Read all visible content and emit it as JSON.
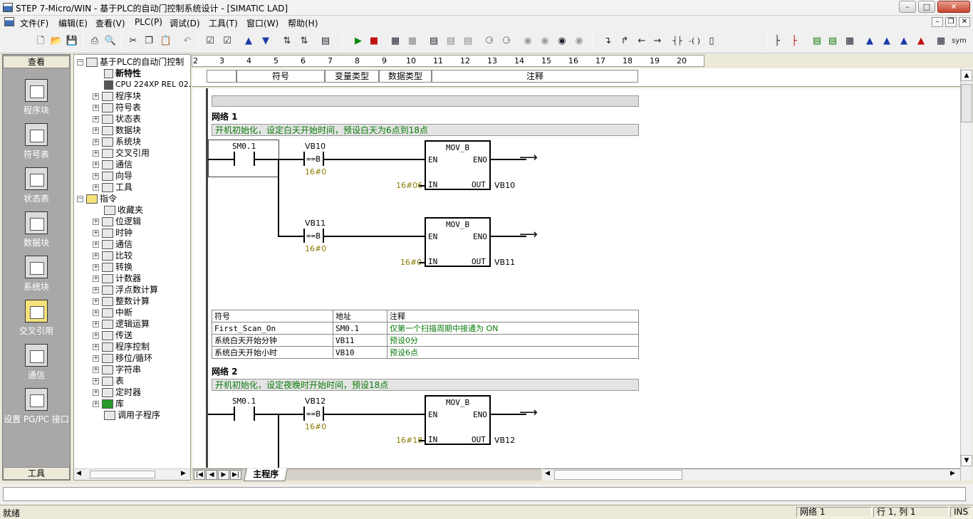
{
  "window": {
    "title": "STEP 7-Micro/WIN - 基于PLC的自动门控制系统设计 - [SIMATIC LAD]"
  },
  "menu": [
    {
      "label": "文件(F)"
    },
    {
      "label": "编辑(E)"
    },
    {
      "label": "查看(V)"
    },
    {
      "label": "PLC(P)"
    },
    {
      "label": "调试(D)"
    },
    {
      "label": "工具(T)"
    },
    {
      "label": "窗口(W)"
    },
    {
      "label": "帮助(H)"
    }
  ],
  "nav": {
    "header": "查看",
    "footer": "工具",
    "items": [
      {
        "label": "程序块",
        "icon": "program-block-icon"
      },
      {
        "label": "符号表",
        "icon": "symbol-table-icon"
      },
      {
        "label": "状态表",
        "icon": "status-table-icon"
      },
      {
        "label": "数据块",
        "icon": "data-block-icon"
      },
      {
        "label": "系统块",
        "icon": "system-block-icon"
      },
      {
        "label": "交叉引用",
        "icon": "cross-reference-icon"
      },
      {
        "label": "通信",
        "icon": "communication-icon"
      },
      {
        "label": "设置 PG/PC 接口",
        "icon": "pgpc-interface-icon"
      }
    ]
  },
  "tree": {
    "root": "基于PLC的自动门控制",
    "items": [
      {
        "label": "新特性"
      },
      {
        "label": "CPU 224XP REL 02."
      },
      {
        "label": "程序块"
      },
      {
        "label": "符号表"
      },
      {
        "label": "状态表"
      },
      {
        "label": "数据块"
      },
      {
        "label": "系统块"
      },
      {
        "label": "交叉引用"
      },
      {
        "label": "通信"
      },
      {
        "label": "向导"
      },
      {
        "label": "工具"
      }
    ],
    "instructions": "指令",
    "instr_items": [
      {
        "label": "收藏夹"
      },
      {
        "label": "位逻辑"
      },
      {
        "label": "时钟"
      },
      {
        "label": "通信"
      },
      {
        "label": "比较"
      },
      {
        "label": "转换"
      },
      {
        "label": "计数器"
      },
      {
        "label": "浮点数计算"
      },
      {
        "label": "整数计算"
      },
      {
        "label": "中断"
      },
      {
        "label": "逻辑运算"
      },
      {
        "label": "传送"
      },
      {
        "label": "程序控制"
      },
      {
        "label": "移位/循环"
      },
      {
        "label": "字符串"
      },
      {
        "label": "表"
      },
      {
        "label": "定时器"
      },
      {
        "label": "库"
      },
      {
        "label": "调用子程序"
      }
    ]
  },
  "ruler": [
    "2",
    "3",
    "4",
    "5",
    "6",
    "7",
    "8",
    "9",
    "10",
    "11",
    "12",
    "13",
    "14",
    "15",
    "16",
    "17",
    "18",
    "19",
    "20"
  ],
  "symbol_header": {
    "col1": "符号",
    "col2": "变量类型",
    "col3": "数据类型",
    "col4": "注释"
  },
  "network1": {
    "title": "网络 1",
    "comment": "开机初始化，设定白天开始时间，预设白天为6点到18点",
    "contact": "SM0.1",
    "rung1": {
      "compare_var": "VB10",
      "compare_op": "==B",
      "compare_val": "16#0",
      "block": "MOV_B",
      "en": "EN",
      "eno": "ENO",
      "in_val": "16#06",
      "in": "IN",
      "out": "OUT",
      "out_var": "VB10"
    },
    "rung2": {
      "compare_var": "VB11",
      "compare_op": "==B",
      "compare_val": "16#0",
      "block": "MOV_B",
      "en": "EN",
      "eno": "ENO",
      "in_val": "16#0",
      "in": "IN",
      "out": "OUT",
      "out_var": "VB11"
    },
    "table": {
      "headers": [
        "符号",
        "地址",
        "注释"
      ],
      "rows": [
        [
          "First_Scan_On",
          "SM0.1",
          "仅第一个扫描周期中接通为 ON"
        ],
        [
          "系统白天开始分钟",
          "VB11",
          "预设0分"
        ],
        [
          "系统白天开始小时",
          "VB10",
          "预设6点"
        ]
      ]
    }
  },
  "network2": {
    "title": "网络 2",
    "comment": "开机初始化，设定夜晚时开始时间，预设18点",
    "contact": "SM0.1",
    "rung1": {
      "compare_var": "VB12",
      "compare_op": "==B",
      "compare_val": "16#0",
      "block": "MOV_B",
      "en": "EN",
      "eno": "ENO",
      "in_val": "16#18",
      "in": "IN",
      "out": "OUT",
      "out_var": "VB12"
    }
  },
  "tabs": {
    "main": "主程序"
  },
  "status": {
    "left": "就绪",
    "network": "网络 1",
    "position": "行 1, 列 1",
    "mode": "INS"
  },
  "colors": {
    "comment_text": "#0a7a0a",
    "constant_text": "#8a7a00",
    "nav_bg": "#a8a8a8"
  }
}
